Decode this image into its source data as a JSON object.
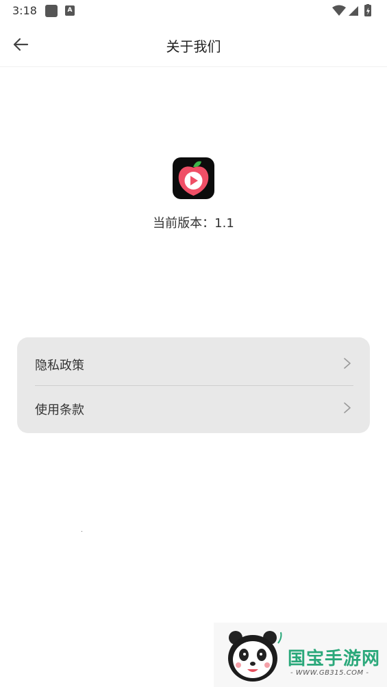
{
  "status_bar": {
    "time": "3:18",
    "notification_icons": [
      "app-square-icon",
      "a-icon"
    ],
    "system_icons": [
      "wifi-icon",
      "signal-icon",
      "battery-icon"
    ],
    "a_label": "A"
  },
  "header": {
    "title": "关于我们",
    "back_icon": "arrow-left-icon"
  },
  "app_info": {
    "logo_icon": "peach-play-logo",
    "version_label": "当前版本：1.1"
  },
  "menu": {
    "items": [
      {
        "label": "隐私政策",
        "icon": "chevron-right-icon"
      },
      {
        "label": "使用条款",
        "icon": "chevron-right-icon"
      }
    ]
  },
  "watermark": {
    "brand": "国宝手游网",
    "url": "- WWW.GB315.COM -",
    "mascot_icon": "panda-icon"
  },
  "colors": {
    "background": "#ffffff",
    "card": "#e8e8e8",
    "logo_bg": "#0c0c0c",
    "logo_peach": "#ef4f66",
    "logo_leaf": "#3bb54a",
    "watermark_green": "#2aa87a"
  }
}
